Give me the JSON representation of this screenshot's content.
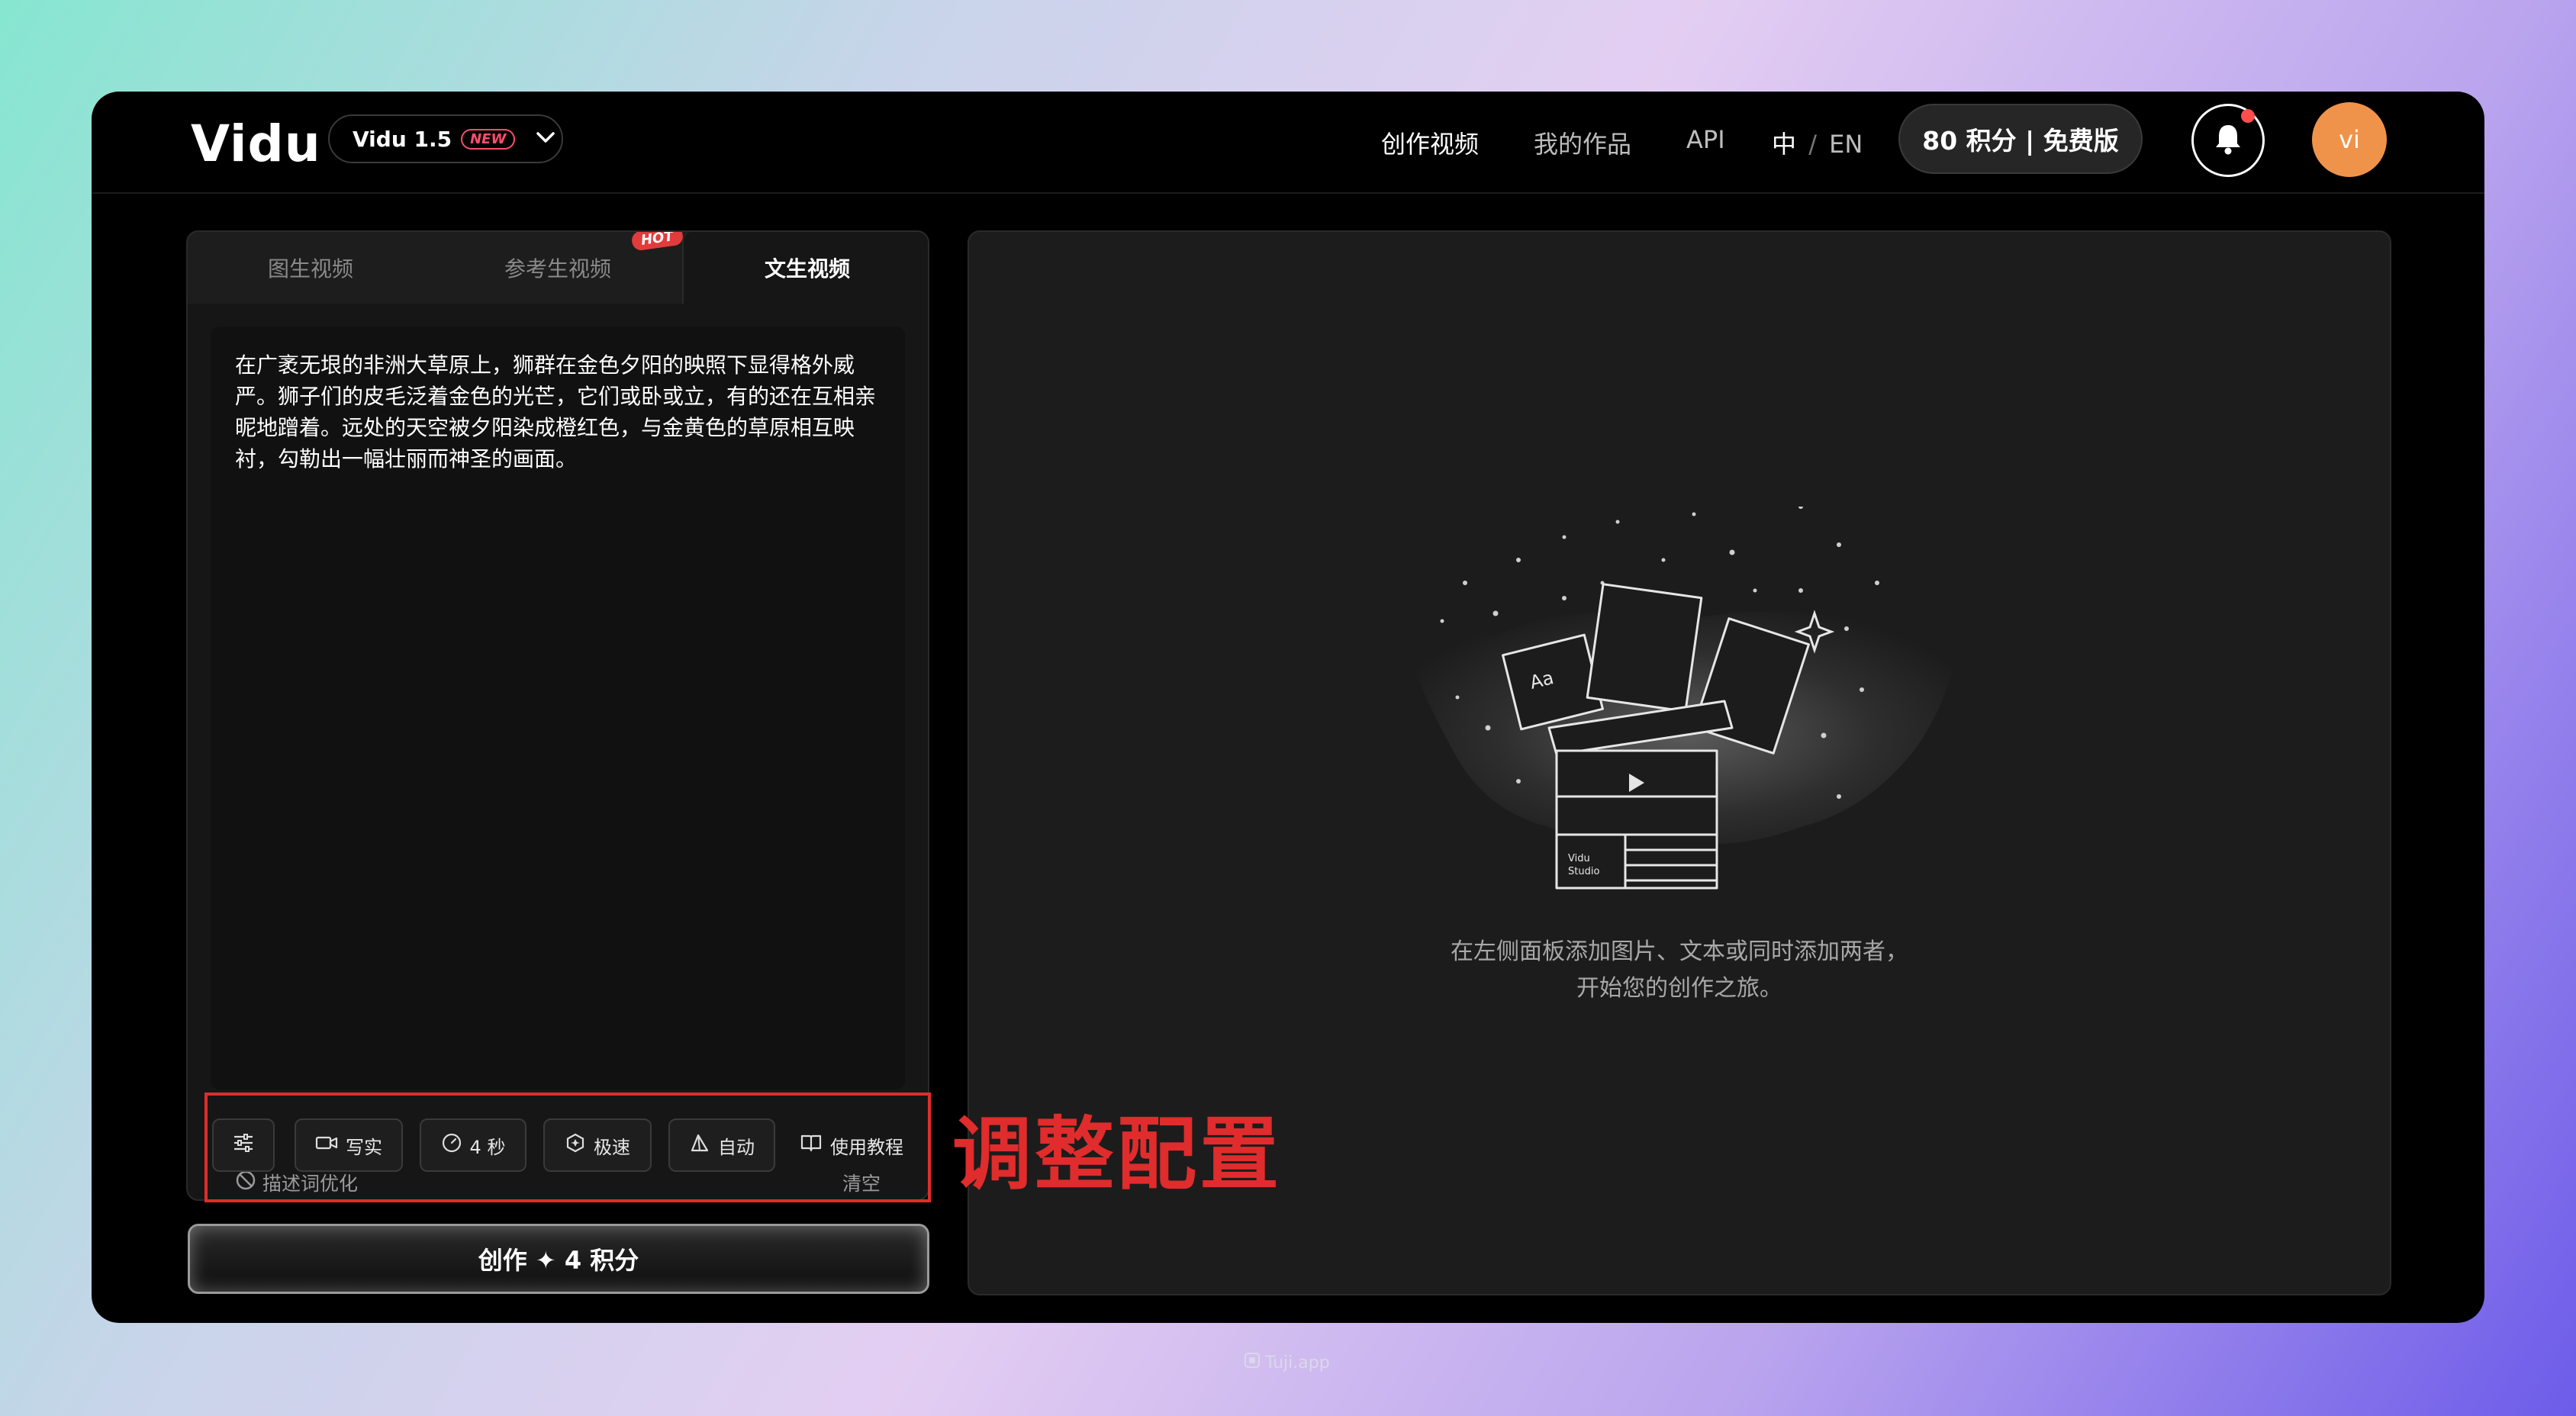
{
  "app": {
    "logo": "Vidu",
    "version_label": "Vidu 1.5",
    "version_badge": "NEW"
  },
  "nav": {
    "create_video": "创作视频",
    "my_works": "我的作品",
    "api": "API",
    "lang_zh": "中",
    "lang_sep": "/",
    "lang_en": "EN",
    "credits": "80 积分 | 免费版",
    "avatar_text": "vi"
  },
  "tabs": {
    "image_to_video": "图生视频",
    "reference_to_video": "参考生视频",
    "hot_badge": "HOT",
    "text_to_video": "文生视频"
  },
  "prompt": {
    "text": "在广袤无垠的非洲大草原上，狮群在金色夕阳的映照下显得格外威严。狮子们的皮毛泛着金色的光芒，它们或卧或立，有的还在互相亲昵地蹭着。远处的天空被夕阳染成橙红色，与金黄色的草原相互映衬，勾勒出一幅壮丽而神圣的画面。",
    "optimize_label": "描述词优化",
    "clear_label": "清空"
  },
  "toolbar": {
    "style_label": "写实",
    "duration_label": "4 秒",
    "speed_label": "极速",
    "aspect_label": "自动",
    "tutorial_label": "使用教程"
  },
  "annotation": {
    "label": "调整配置",
    "color": "#e02c2c"
  },
  "create_button": {
    "label": "创作 ✦ 4 积分"
  },
  "empty_state": {
    "line1": "在左侧面板添加图片、文本或同时添加两者，",
    "line2": "开始您的创作之旅。",
    "studio_text_1": "Vidu",
    "studio_text_2": "Studio",
    "card_text": "Aa"
  },
  "watermark": {
    "label": "Tuji.app"
  },
  "colors": {
    "accent_avatar": "#f0934a",
    "notification_dot": "#ff4d4d",
    "hot_badge": "#e23b3b",
    "new_badge": "#ff4d6d"
  }
}
